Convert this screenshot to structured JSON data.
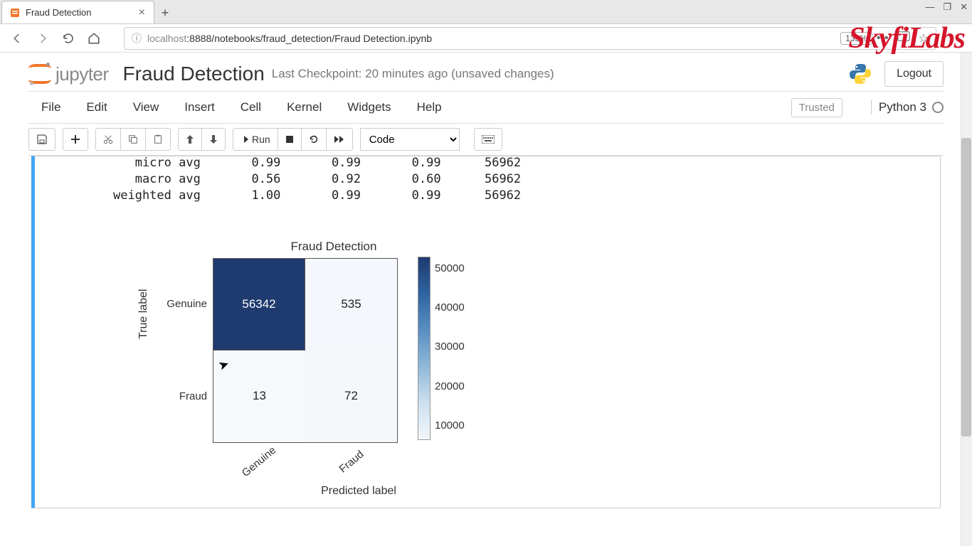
{
  "browser": {
    "tab_title": "Fraud Detection",
    "url_host": "localhost",
    "url_port_path": ":8888/notebooks/fraud_detection/Fraud Detection.ipynb",
    "zoom": "133%"
  },
  "brand": "SkyfiLabs",
  "header": {
    "jupyter": "jupyter",
    "title": "Fraud Detection",
    "checkpoint": "Last Checkpoint: 20 minutes ago   (unsaved changes)",
    "logout": "Logout"
  },
  "menu": [
    "File",
    "Edit",
    "View",
    "Insert",
    "Cell",
    "Kernel",
    "Widgets",
    "Help"
  ],
  "trusted": "Trusted",
  "kernel": "Python 3",
  "toolbar": {
    "run": "Run",
    "cell_type": "Code"
  },
  "report_rows": [
    {
      "label": "   micro avg",
      "p": "0.99",
      "r": "0.99",
      "f": "0.99",
      "s": "56962"
    },
    {
      "label": "   macro avg",
      "p": "0.56",
      "r": "0.92",
      "f": "0.60",
      "s": "56962"
    },
    {
      "label": "weighted avg",
      "p": "1.00",
      "r": "0.99",
      "f": "0.99",
      "s": "56962"
    }
  ],
  "chart_data": {
    "type": "heatmap",
    "title": "Fraud Detection",
    "xlabel": "Predicted label",
    "ylabel": "True label",
    "xticks": [
      "Genuine",
      "Fraud"
    ],
    "yticks": [
      "Genuine",
      "Fraud"
    ],
    "matrix": [
      [
        56342,
        535
      ],
      [
        13,
        72
      ]
    ],
    "colorbar_ticks": [
      "50000",
      "40000",
      "30000",
      "20000",
      "10000"
    ],
    "colormap_range": [
      0,
      56342
    ]
  }
}
